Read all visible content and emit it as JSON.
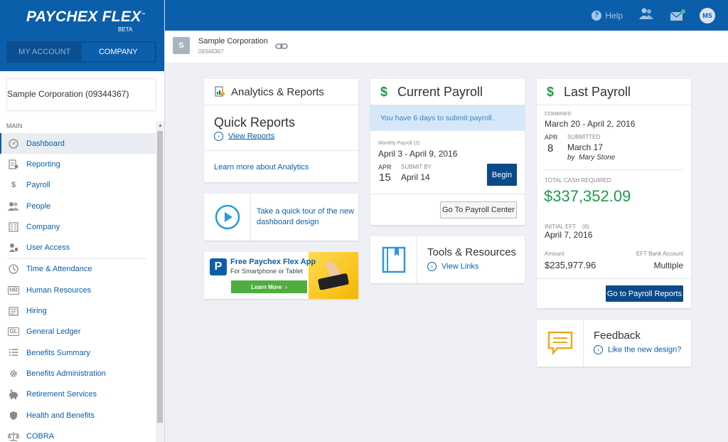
{
  "brand": {
    "logo": "PAYCHEX FLEX",
    "tm": "™",
    "beta": "BETA"
  },
  "account_toggle": {
    "my_account": "MY ACCOUNT",
    "company": "COMPANY"
  },
  "topbar": {
    "help": "Help",
    "avatar": "MS"
  },
  "sidebar": {
    "company": "Sample Corporation (09344367)",
    "section": "MAIN",
    "items": [
      {
        "label": "Dashboard",
        "icon": "dashboard-icon"
      },
      {
        "label": "Reporting",
        "icon": "reporting-icon"
      },
      {
        "label": "Payroll",
        "icon": "dollar-icon"
      },
      {
        "label": "People",
        "icon": "people-icon"
      },
      {
        "label": "Company",
        "icon": "company-icon"
      },
      {
        "label": "User Access",
        "icon": "user-access-icon"
      },
      {
        "label": "Time & Attendance",
        "icon": "clock-icon"
      },
      {
        "label": "Human Resources",
        "icon": "hr-icon",
        "glyph": "HR"
      },
      {
        "label": "Hiring",
        "icon": "hiring-icon"
      },
      {
        "label": "General Ledger",
        "icon": "gl-icon",
        "glyph": "GL"
      },
      {
        "label": "Benefits Summary",
        "icon": "list-icon"
      },
      {
        "label": "Benefits Administration",
        "icon": "gear-icon"
      },
      {
        "label": "Retirement Services",
        "icon": "piggy-bank-icon"
      },
      {
        "label": "Health and Benefits",
        "icon": "shield-icon"
      },
      {
        "label": "COBRA",
        "icon": "scales-icon"
      }
    ]
  },
  "company_strip": {
    "badge": "S",
    "name": "Sample Corporation",
    "id": "09344367"
  },
  "analytics": {
    "title": "Analytics & Reports",
    "quick_reports": "Quick Reports",
    "view_reports": "View Reports",
    "learn_more": "Learn more about Analytics"
  },
  "tour": {
    "text_line1": "Take a quick tour of the new",
    "text_line2": "dashboard design"
  },
  "app_banner": {
    "title": "Free Paychex Flex App",
    "subtitle": "For Smartphone or Tablet",
    "button": "Learn More"
  },
  "current_payroll": {
    "title": "Current Payroll",
    "alert": "You have 6 days to submit payroll.",
    "label": "Monthly Payroll (2)",
    "period": "April 3 - April 9, 2016",
    "month": "APR",
    "day": "15",
    "submit_by_label": "SUBMIT BY",
    "submit_by": "April 14",
    "begin": "Begin",
    "go_to": "Go To Payroll Center"
  },
  "tools": {
    "title": "Tools & Resources",
    "link": "View Links"
  },
  "last_payroll": {
    "title": "Last Payroll",
    "combined_label": "COMBINED",
    "period": "March 20 - April 2, 2016",
    "month": "APR",
    "day": "8",
    "submitted_label": "SUBMITTED",
    "submitted_date": "March 17",
    "by": "by",
    "submitter": "Mary Stone",
    "total_label": "TOTAL CASH REQUIRED",
    "total": "$337,352.09",
    "eft_label": "INITIAL EFT",
    "eft_count": "(6)",
    "eft_date": "April 7, 2016",
    "amount_label": "Amount",
    "amount": "$235,977.96",
    "bank_label": "EFT Bank Account",
    "bank": "Multiple",
    "go_to": "Go to Payroll Reports"
  },
  "feedback": {
    "title": "Feedback",
    "link": "Like the new design?"
  },
  "colors": {
    "brand_blue": "#0b5eaa",
    "green": "#1d9b4e",
    "alert_bg": "#d5e7f8",
    "feedback_orange": "#f0a81c"
  }
}
